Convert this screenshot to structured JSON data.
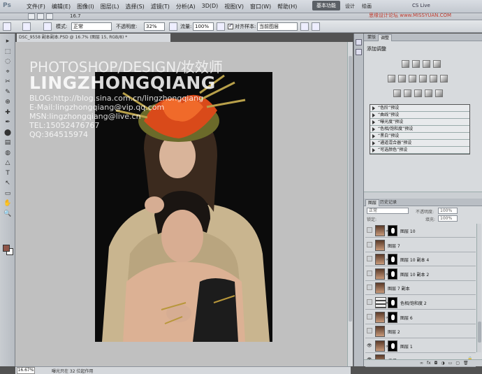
{
  "app": {
    "logo": "Ps",
    "menus": [
      "文件(F)",
      "编辑(E)",
      "图像(I)",
      "图层(L)",
      "选择(S)",
      "滤镜(T)",
      "分析(A)",
      "3D(D)",
      "视图(V)",
      "窗口(W)",
      "帮助(H)"
    ],
    "zoom_mini": "16.7",
    "workspace_active": "基本功能",
    "workspace_design": "设计",
    "workspace_paint": "绘画",
    "cs_live": "CS Live",
    "watermark_site": "思缘设计论坛 www.MISSYUAN.COM"
  },
  "options": {
    "mode_label": "模式:",
    "mode_value": "正常",
    "opacity_label": "不透明度:",
    "opacity_value": "32%",
    "flow_label": "流量:",
    "flow_value": "100%",
    "align_label": "对齐",
    "sample_label": "样本:",
    "sample_value": "当前图层"
  },
  "document": {
    "tab_title": "DSC_9558 副本副本.PSD @ 16.7% (图层 15, RGB/8) *",
    "watermark": {
      "title": "PHOTOSHOP/DESIGN/妆效师",
      "name": "LINGZHONGQIANG",
      "blog": "BLOG:http://blog.sina.com.cn/lingzhongqiang",
      "email": "E-Mail:lingzhongqiang@vip.qq.com",
      "msn": "MSN:lingzhongqiang@live.cn",
      "tel": "TEL:15052476767",
      "qq": "QQ:364515974"
    }
  },
  "status": {
    "zoom": "16.67%",
    "message": "曝光只在 32 位起作用"
  },
  "adjust_panel": {
    "tabs": [
      "蒙版",
      "调整"
    ],
    "title": "添加调整",
    "presets": [
      "“色阶”预设",
      "“曲线”预设",
      "“曝光度”预设",
      "“色相/饱和度”预设",
      "“黑白”预设",
      "“通道混合器”预设",
      "“可选颜色”预设"
    ]
  },
  "layers_panel": {
    "tabs": [
      "图层",
      "历史记录"
    ],
    "blend_mode": "正常",
    "opacity_label": "不透明度:",
    "opacity_value": "100%",
    "lock_label": "锁定:",
    "fill_label": "填充:",
    "fill_value": "100%",
    "layers": [
      {
        "name": "图层 10",
        "mask": true,
        "eye": false
      },
      {
        "name": "图层 7",
        "mask": false,
        "eye": false
      },
      {
        "name": "图层 10 副本 4",
        "mask": true,
        "eye": false
      },
      {
        "name": "图层 10 副本 2",
        "mask": true,
        "eye": false
      },
      {
        "name": "图层 7 副本",
        "mask": false,
        "eye": false
      },
      {
        "name": "色相/饱和度 2",
        "mask": true,
        "eye": false,
        "adjustment": true
      },
      {
        "name": "图层 6",
        "mask": true,
        "eye": false
      },
      {
        "name": "图层 2",
        "mask": false,
        "eye": false
      },
      {
        "name": "图层 1",
        "mask": true,
        "eye": true
      },
      {
        "name": "背景",
        "mask": false,
        "eye": true,
        "locked": true
      }
    ]
  }
}
